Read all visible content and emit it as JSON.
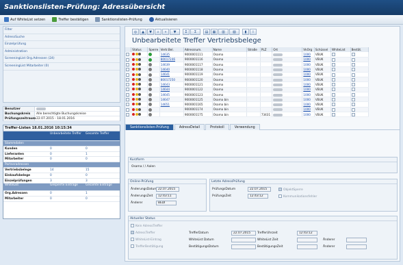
{
  "window": {
    "title": "Sanktionslisten-Prüfung: Adressübersicht"
  },
  "toolbar": {
    "b1": "Auf WhiteList setzen",
    "b2": "Treffer bestätigen",
    "b3": "Sanktionslisten-Prüfung",
    "b4": "Aktualisieren"
  },
  "nav": {
    "items": [
      "Filter",
      "AdressSuche",
      "Einzelprüfung",
      "Administration",
      "ScreeningList Org.Adressen (24)",
      "ScreeningList Mitarbeiter (0)"
    ]
  },
  "info": {
    "benutzer_label": "Benutzer",
    "bukrs_label": "Buchungskreis",
    "bukrs_value": "Alle berechtigte Buchungskreise",
    "zeitraum_label": "Prüfungszeitraum",
    "zeitraum_value": "22.07.2015 - 18.01.2016"
  },
  "stats": {
    "title": "Treffer-Listen 18.01.2016 10:15:34",
    "h1": "Unbearbeitete Treffer",
    "h2": "Gesamte Treffer",
    "sec1": "Stammdaten",
    "rows1": [
      {
        "k": "Kunden",
        "a": "0",
        "b": "0"
      },
      {
        "k": "Lieferanten",
        "a": "0",
        "b": "1"
      },
      {
        "k": "Mitarbeiter",
        "a": "0",
        "b": "0"
      }
    ],
    "sec2": "Partneradressen",
    "rows2": [
      {
        "k": "Vertriebsbelege",
        "a": "14",
        "b": "15"
      },
      {
        "k": "Einkaufsbelege",
        "a": "0",
        "b": "0"
      },
      {
        "k": "Einzelprüfungen",
        "a": "3",
        "b": "3"
      }
    ],
    "sec3a": "WhiteList",
    "sec3b": "Gesperrte Einträge",
    "sec3c": "Gesamte Einträge",
    "rows3": [
      {
        "k": "Org.Adressen",
        "a": "0",
        "b": "1"
      },
      {
        "k": "Mitarbeiter",
        "a": "0",
        "b": "0"
      }
    ]
  },
  "table": {
    "title": "Unbearbeitete Treffer Vertriebsbelege",
    "headers": [
      "Status",
      "Sperre",
      "Vertr.Bel.",
      "Adressnum.",
      "Name",
      "Straße",
      "PLZ",
      "Ort",
      "VkOrg",
      "Schüssel",
      "WhiteList",
      "Bestät."
    ],
    "rows": [
      {
        "sp": "green",
        "vb": "14635",
        "an": "9000001111",
        "name": "Osama",
        "plz": "",
        "vk": "1000",
        "sch": "VBUK"
      },
      {
        "sp": "green",
        "vb": "80017246",
        "an": "9000001116",
        "name": "Osama",
        "plz": "",
        "vk": "1000",
        "sch": "VBUK"
      },
      {
        "sp": "grey",
        "vb": "14639",
        "an": "9000001117",
        "name": "Osama",
        "plz": "",
        "vk": "1000",
        "sch": "VBUK"
      },
      {
        "sp": "grey",
        "vb": "14640",
        "an": "9000001118",
        "name": "Osama",
        "plz": "",
        "vk": "1000",
        "sch": "VBUK"
      },
      {
        "sp": "grey",
        "vb": "14641",
        "an": "9000001119",
        "name": "Osama",
        "plz": "",
        "vk": "1000",
        "sch": "VBUK"
      },
      {
        "sp": "grey",
        "vb": "80017250",
        "an": "9000001120",
        "name": "Osama",
        "plz": "",
        "vk": "1000",
        "sch": "VBUK"
      },
      {
        "sp": "grey",
        "vb": "14643",
        "an": "9000001121",
        "name": "Osama",
        "plz": "",
        "vk": "1000",
        "sch": "VBUK"
      },
      {
        "sp": "grey",
        "vb": "14644",
        "an": "9000001122",
        "name": "Osama",
        "plz": "",
        "vk": "1000",
        "sch": "VBUK"
      },
      {
        "sp": "grey",
        "vb": "14645",
        "an": "9000001123",
        "name": "Osama",
        "plz": "",
        "vk": "1000",
        "sch": "VBUK"
      },
      {
        "sp": "grey",
        "vb": "14647",
        "an": "9000001125",
        "name": "Osama bin",
        "plz": "",
        "vk": "1000",
        "sch": "VBUK"
      },
      {
        "sp": "grey",
        "vb": "14651",
        "an": "9000001165",
        "name": "Osama bin",
        "plz": "",
        "vk": "1000",
        "sch": "VBUK"
      },
      {
        "sp": "grey",
        "vb": "",
        "an": "9000001174",
        "name": "Osama bin",
        "plz": "",
        "vk": "1000",
        "sch": "VBUK"
      },
      {
        "sp": "grey",
        "vb": "",
        "an": "9000001175",
        "name": "Osama bin",
        "plz": "73431",
        "vk": "1000",
        "sch": "VBUK"
      }
    ]
  },
  "tabs": [
    "Sanktionslisten-Prüfung",
    "AdressDetail",
    "Protokoll",
    "Verwendung"
  ],
  "detail": {
    "kurzform_title": "Kurzform",
    "kurzform_value": "Osama / / Aalen",
    "online_title": "Online-Prüfung",
    "aend_datum_label": "ÄnderungsDatum",
    "aend_datum": "22.07.2015",
    "aend_zeit_label": "ÄnderungsZeit",
    "aend_zeit": "12:43:11",
    "aenderer_label": "Änderer",
    "aenderer": "BEDI",
    "letzte_title": "Letzte AdressPrüfung",
    "pr_datum_label": "PrüfungsDatum",
    "pr_datum": "22.07.2015",
    "pr_zeit_label": "PrüfungsZeit",
    "pr_zeit": "12:43:12",
    "objektsperre": "ObjektSperre",
    "kommfehler": "Kommunikationsfehler",
    "status_title": "Aktueller Status",
    "kein_treffer": "Kein AdressTreffer",
    "adress_treffer": "AdressTreffer",
    "whitelist_eintrag": "WhiteList-Eintrag",
    "treffer_best": "TrefferBestätigung",
    "treffer_datum_label": "TrefferDatum",
    "treffer_datum": "22.07.2015",
    "treffer_uhrzeit_label": "TrefferUhrzeit",
    "treffer_uhrzeit": "12:43:12",
    "wl_datum_label": "WhiteList Datum",
    "wl_zeit_label": "WhiteList Zeit",
    "aenderer2_label": "Änderer",
    "best_datum_label": "BestätigungsDatum",
    "best_zeit_label": "BestätigungsZeit",
    "aenderer3_label": "Änderer"
  }
}
